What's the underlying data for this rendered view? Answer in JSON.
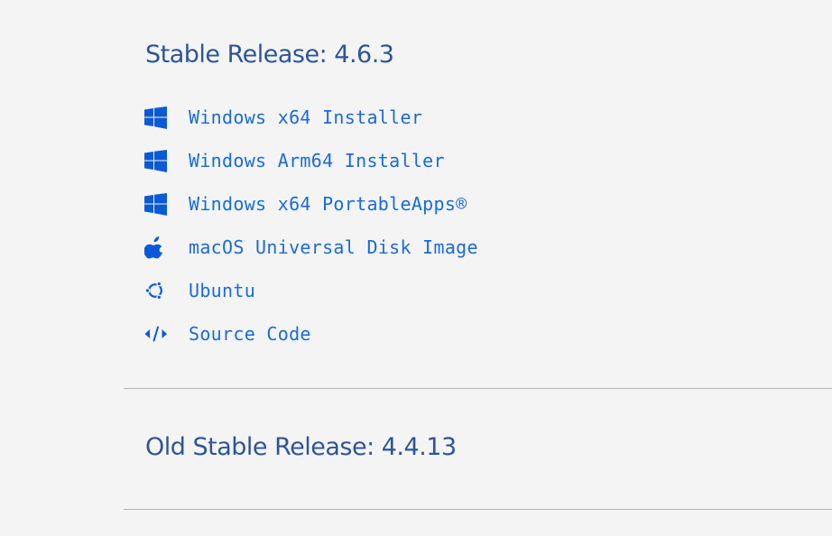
{
  "stable_release": {
    "title": "Stable Release: 4.6.3",
    "downloads": [
      {
        "label": "Windows x64 Installer",
        "icon": "windows-icon"
      },
      {
        "label": "Windows Arm64 Installer",
        "icon": "windows-icon"
      },
      {
        "label": "Windows x64 PortableApps®",
        "icon": "windows-icon"
      },
      {
        "label": "macOS Universal Disk Image",
        "icon": "apple-icon"
      },
      {
        "label": "Ubuntu",
        "icon": "ubuntu-icon"
      },
      {
        "label": "Source Code",
        "icon": "code-icon"
      }
    ]
  },
  "old_stable_release": {
    "title": "Old Stable Release: 4.4.13"
  },
  "colors": {
    "background": "#f4f4f4",
    "heading": "#2e5597",
    "link": "#1a6bd8",
    "icon": "#0a5ad6",
    "divider": "#b4b4b4"
  }
}
